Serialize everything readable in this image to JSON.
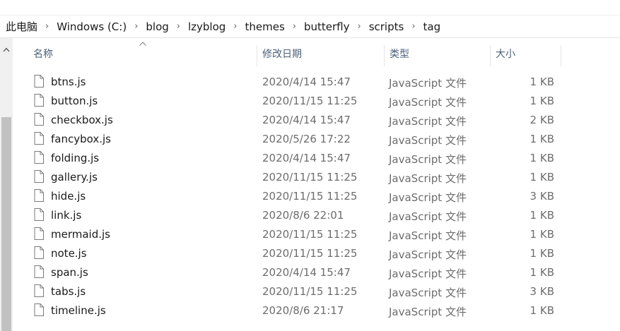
{
  "breadcrumb": [
    "此电脑",
    "Windows (C:)",
    "blog",
    "lzyblog",
    "themes",
    "butterfly",
    "scripts",
    "tag"
  ],
  "columns": {
    "name": "名称",
    "date": "修改日期",
    "type": "类型",
    "size": "大小"
  },
  "files": [
    {
      "name": "btns.js",
      "date": "2020/4/14 15:47",
      "type": "JavaScript 文件",
      "size": "1 KB"
    },
    {
      "name": "button.js",
      "date": "2020/11/15 11:25",
      "type": "JavaScript 文件",
      "size": "1 KB"
    },
    {
      "name": "checkbox.js",
      "date": "2020/4/14 15:47",
      "type": "JavaScript 文件",
      "size": "2 KB"
    },
    {
      "name": "fancybox.js",
      "date": "2020/5/26 17:22",
      "type": "JavaScript 文件",
      "size": "1 KB"
    },
    {
      "name": "folding.js",
      "date": "2020/4/14 15:47",
      "type": "JavaScript 文件",
      "size": "1 KB"
    },
    {
      "name": "gallery.js",
      "date": "2020/11/15 11:25",
      "type": "JavaScript 文件",
      "size": "1 KB"
    },
    {
      "name": "hide.js",
      "date": "2020/11/15 11:25",
      "type": "JavaScript 文件",
      "size": "3 KB"
    },
    {
      "name": "link.js",
      "date": "2020/8/6 22:01",
      "type": "JavaScript 文件",
      "size": "1 KB"
    },
    {
      "name": "mermaid.js",
      "date": "2020/11/15 11:25",
      "type": "JavaScript 文件",
      "size": "1 KB"
    },
    {
      "name": "note.js",
      "date": "2020/11/15 11:25",
      "type": "JavaScript 文件",
      "size": "1 KB"
    },
    {
      "name": "span.js",
      "date": "2020/4/14 15:47",
      "type": "JavaScript 文件",
      "size": "1 KB"
    },
    {
      "name": "tabs.js",
      "date": "2020/11/15 11:25",
      "type": "JavaScript 文件",
      "size": "3 KB"
    },
    {
      "name": "timeline.js",
      "date": "2020/8/6 21:17",
      "type": "JavaScript 文件",
      "size": "1 KB"
    }
  ],
  "icons": {
    "file": "file-icon",
    "breadcrumb_separator": "chevron-right-icon",
    "sort": "sort-ascending-icon",
    "scroll_up": "chevron-up-icon"
  },
  "colors": {
    "header_text": "#4c607a",
    "secondary_text": "#6d6d6d",
    "scrollbar_thumb": "#c1c1c1"
  }
}
